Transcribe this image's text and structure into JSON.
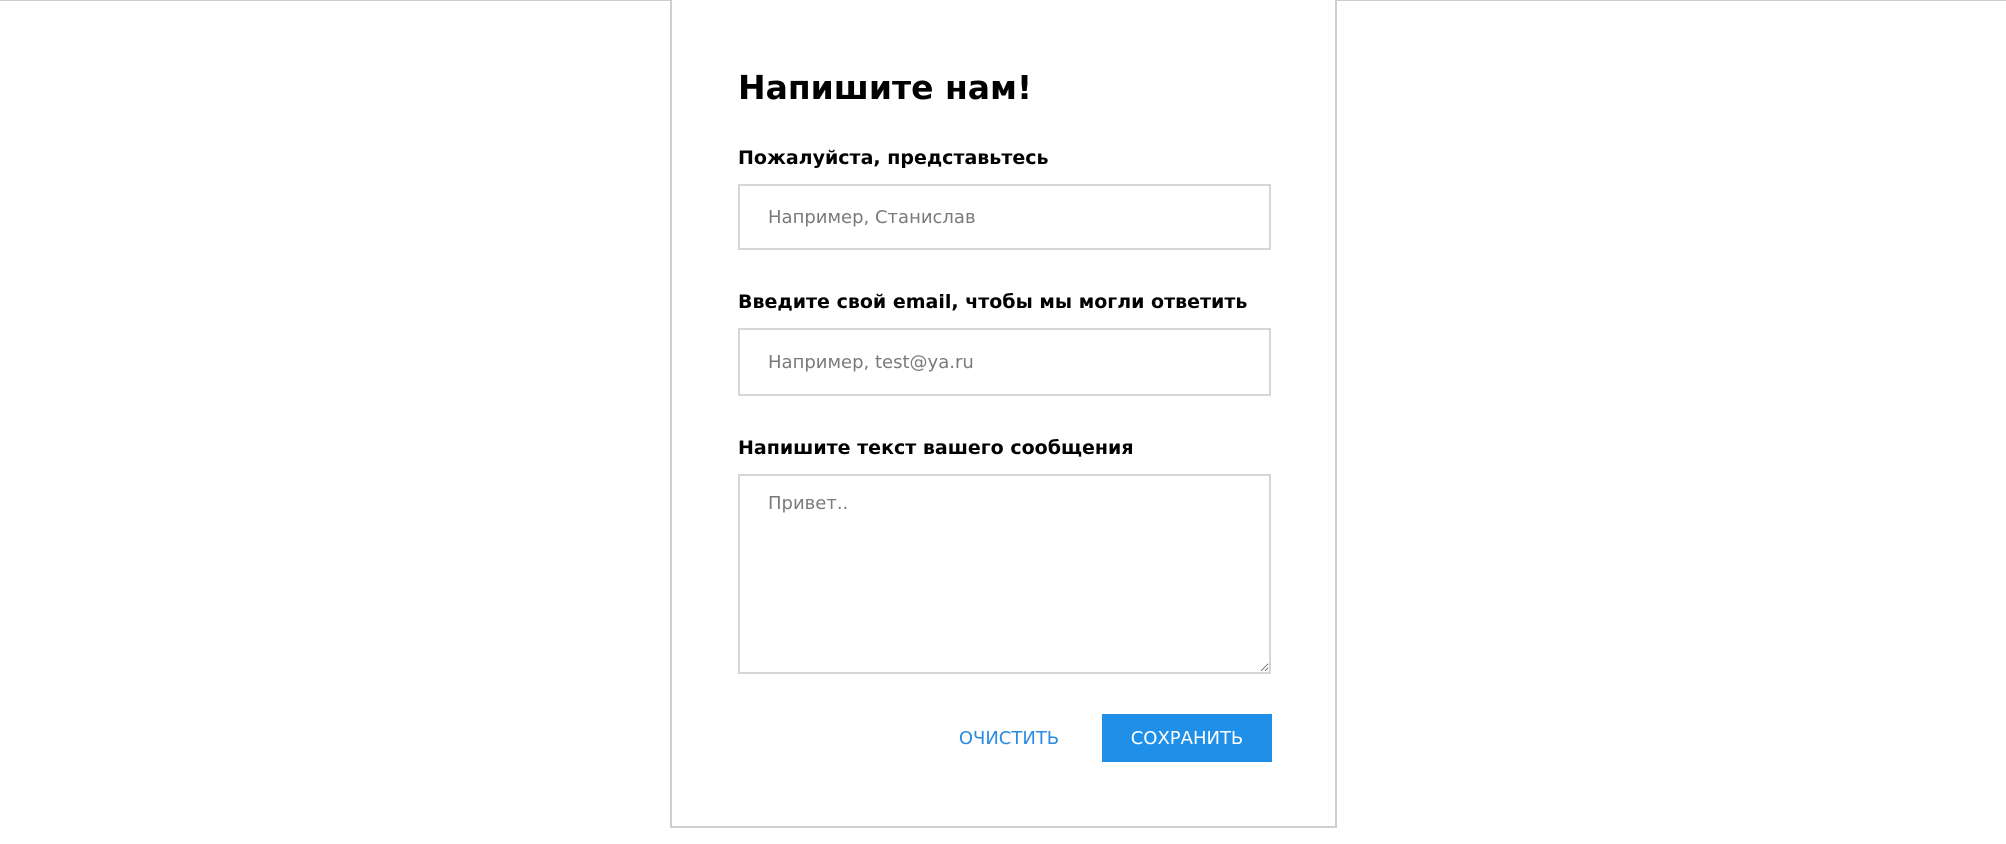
{
  "form": {
    "title": "Напишите нам!",
    "name_label": "Пожалуйста, представьтесь",
    "name_placeholder": "Например, Станислав",
    "email_label": "Введите свой email, чтобы мы могли ответить",
    "email_placeholder": "Например, test@ya.ru",
    "message_label": "Напишите текст вашего сообщения",
    "message_placeholder": "Привет..",
    "clear_label": "ОЧИСТИТЬ",
    "save_label": "СОХРАНИТЬ"
  },
  "colors": {
    "accent": "#1f8fe8",
    "link": "#2a8be0",
    "border": "#d6d6d6"
  }
}
